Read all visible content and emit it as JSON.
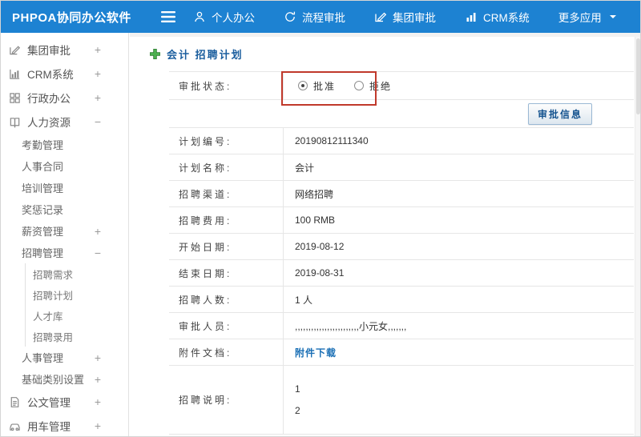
{
  "topbar": {
    "brand": "PHPOA协同办公软件",
    "menu": [
      {
        "label": "个人办公"
      },
      {
        "label": "流程审批"
      },
      {
        "label": "集团审批"
      },
      {
        "label": "CRM系统"
      },
      {
        "label": "更多应用"
      }
    ]
  },
  "sidebar": {
    "items": [
      {
        "label": "集团审批",
        "toggle": "+"
      },
      {
        "label": "CRM系统",
        "toggle": "+"
      },
      {
        "label": "行政办公",
        "toggle": "+"
      },
      {
        "label": "人力资源",
        "toggle": "−"
      },
      {
        "label": "考勤管理",
        "toggle": ""
      },
      {
        "label": "人事合同",
        "toggle": ""
      },
      {
        "label": "培训管理",
        "toggle": ""
      },
      {
        "label": "奖惩记录",
        "toggle": ""
      },
      {
        "label": "薪资管理",
        "toggle": "+"
      },
      {
        "label": "招聘管理",
        "toggle": "−"
      },
      {
        "label": "招聘需求",
        "toggle": ""
      },
      {
        "label": "招聘计划",
        "toggle": ""
      },
      {
        "label": "人才库",
        "toggle": ""
      },
      {
        "label": "招聘录用",
        "toggle": ""
      },
      {
        "label": "人事管理",
        "toggle": "+"
      },
      {
        "label": "基础类别设置",
        "toggle": "+"
      },
      {
        "label": "公文管理",
        "toggle": "+"
      },
      {
        "label": "用车管理",
        "toggle": "+"
      }
    ]
  },
  "main": {
    "title": "会计 招聘计划",
    "approval": {
      "label": "审批状态:",
      "approve_label": "批准",
      "reject_label": "拒绝",
      "button_label": "审批信息"
    },
    "fields": [
      {
        "label": "计划编号:",
        "value": "20190812111340"
      },
      {
        "label": "计划名称:",
        "value": "会计"
      },
      {
        "label": "招聘渠道:",
        "value": "网络招聘"
      },
      {
        "label": "招聘费用:",
        "value": "100 RMB"
      },
      {
        "label": "开始日期:",
        "value": "2019-08-12"
      },
      {
        "label": "结束日期:",
        "value": "2019-08-31"
      },
      {
        "label": "招聘人数:",
        "value": "1 人"
      },
      {
        "label": "审批人员:",
        "value": ",,,,,,,,,,,,,,,,,,,,,,,,小元女,,,,,,,"
      },
      {
        "label": "附件文档:",
        "value": "附件下载"
      },
      {
        "label": "招聘说明:",
        "value": "1\n2"
      }
    ]
  },
  "colors": {
    "topbar_blue": "#1d82d2",
    "title_blue": "#1b5e9e",
    "link_blue": "#1a6fb5",
    "annotation_red": "#c0392b",
    "plus_green": "#4caf50"
  }
}
